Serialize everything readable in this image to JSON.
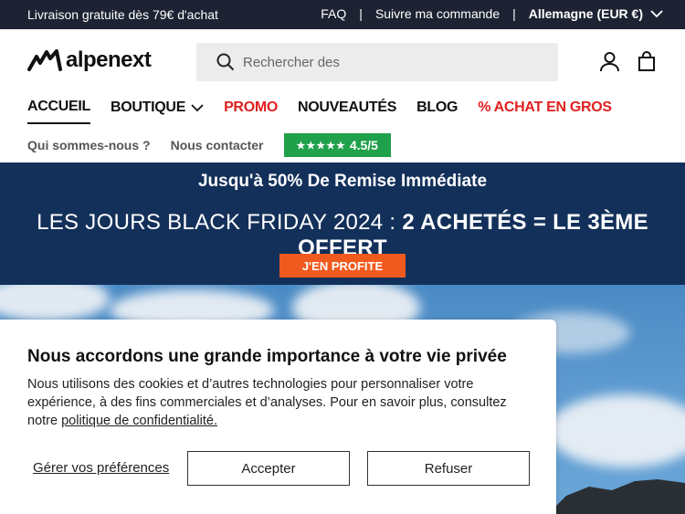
{
  "topbar": {
    "promo": "Livraison gratuite dès 79€ d'achat",
    "faq": "FAQ",
    "track": "Suivre ma commande",
    "region": "Allemagne (EUR €)"
  },
  "header": {
    "logo_text": "alpenext",
    "search_placeholder": "Rechercher des"
  },
  "nav": {
    "items": [
      {
        "label": "ACCUEIL"
      },
      {
        "label": "BOUTIQUE"
      },
      {
        "label": "PROMO"
      },
      {
        "label": "NOUVEAUTÉS"
      },
      {
        "label": "BLOG"
      },
      {
        "label": "% ACHAT EN GROS"
      }
    ],
    "sub": [
      {
        "label": "Qui sommes-nous ?"
      },
      {
        "label": "Nous contacter"
      }
    ],
    "rating_stars": "★★★★★",
    "rating": "4.5/5"
  },
  "banner": {
    "line1": "Jusqu'à 50% De Remise Immédiate",
    "line2_prefix": "LES JOURS BLACK FRIDAY 2024 : ",
    "line2_bold": "2 ACHETÉS = LE 3ÈME OFFERT",
    "cta": "J'EN PROFITE"
  },
  "cookie": {
    "title": "Nous accordons une grande importance à votre vie privée",
    "text": "Nous utilisons des cookies et d’autres technologies pour personnaliser votre expérience, à des fins commerciales et d’analyses. Pour en savoir plus, consultez notre ",
    "link": "politique de confidentialité.",
    "prefs": "Gérer vos préférences",
    "accept": "Accepter",
    "refuse": "Refuser"
  },
  "colors": {
    "topbar_bg": "#1e2333",
    "banner_bg": "#13305a",
    "accent_red": "#e02020",
    "cta_orange": "#f05a1e",
    "trust_green": "#1fa04a"
  }
}
